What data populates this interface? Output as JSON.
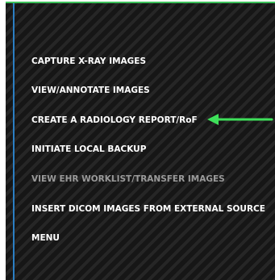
{
  "menu": {
    "items": [
      {
        "label": "CAPTURE X-RAY IMAGES"
      },
      {
        "label": "VIEW/ANNOTATE IMAGES"
      },
      {
        "label": "CREATE A RADIOLOGY REPORT/RoF"
      },
      {
        "label": "INITIATE LOCAL BACKUP"
      },
      {
        "label": "VIEW EHR WORKLIST/TRANSFER IMAGES"
      },
      {
        "label": "INSERT DICOM IMAGES FROM EXTERNAL SOURCE"
      },
      {
        "label": "MENU"
      }
    ]
  },
  "colors": {
    "accent_border": "#3cc15a",
    "left_rule": "#2b7fc4",
    "arrow": "#3ee05a",
    "text": "#ffffff",
    "disabled_text": "#9a9a9a"
  },
  "annotation": {
    "icon": "arrow-left-icon"
  }
}
